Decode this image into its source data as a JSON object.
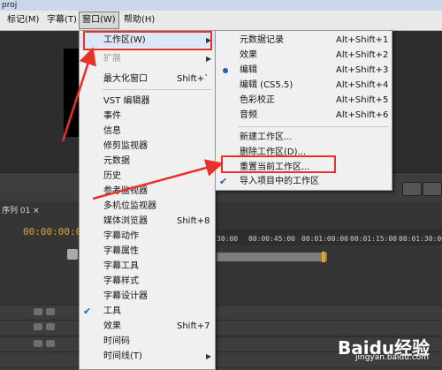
{
  "window": {
    "title": "proj"
  },
  "menubar": {
    "items": [
      {
        "label": "标记(M)",
        "id": "marker"
      },
      {
        "label": "字幕(T)",
        "id": "title"
      },
      {
        "label": "窗口(W)",
        "id": "window",
        "active": true
      },
      {
        "label": "帮助(H)",
        "id": "help"
      }
    ]
  },
  "window_menu": {
    "items": [
      {
        "label": "工作区(W)",
        "submenu": true,
        "highlighted": true
      },
      {
        "label": "扩展",
        "submenu": true,
        "disabled": true
      },
      {
        "label": "最大化窗口",
        "shortcut": "Shift+`"
      },
      {
        "label": "VST 编辑器"
      },
      {
        "label": "事件"
      },
      {
        "label": "信息"
      },
      {
        "label": "修剪监视器"
      },
      {
        "label": "元数据"
      },
      {
        "label": "历史"
      },
      {
        "label": "参考监视器"
      },
      {
        "label": "多机位监视器"
      },
      {
        "label": "媒体浏览器",
        "shortcut": "Shift+8"
      },
      {
        "label": "字幕动作"
      },
      {
        "label": "字幕属性"
      },
      {
        "label": "字幕工具"
      },
      {
        "label": "字幕样式"
      },
      {
        "label": "字幕设计器"
      },
      {
        "label": "工具",
        "checked": true
      },
      {
        "label": "效果",
        "shortcut": "Shift+7"
      },
      {
        "label": "时间码"
      },
      {
        "label": "时间线(T)",
        "submenu": true
      }
    ]
  },
  "workspace_submenu": {
    "items": [
      {
        "label": "元数据记录",
        "shortcut": "Alt+Shift+1"
      },
      {
        "label": "效果",
        "shortcut": "Alt+Shift+2"
      },
      {
        "label": "编辑",
        "shortcut": "Alt+Shift+3",
        "selected": true
      },
      {
        "label": "编辑 (CS5.5)",
        "shortcut": "Alt+Shift+4"
      },
      {
        "label": "色彩校正",
        "shortcut": "Alt+Shift+5"
      },
      {
        "label": "音频",
        "shortcut": "Alt+Shift+6"
      },
      {
        "label": "新建工作区..."
      },
      {
        "label": "删除工作区(D)..."
      },
      {
        "label": "重置当前工作区...",
        "highlighted": true
      },
      {
        "label": "导入项目中的工作区",
        "checked": true
      }
    ]
  },
  "sequence": {
    "tab_label": "序列 01 ×",
    "timecode": "00:00:00:00",
    "ruler": [
      "30:00",
      "00:00:45:00",
      "00:01:00:00",
      "00:01:15:00",
      "00:01:30:00"
    ]
  },
  "watermark": {
    "brand": "Baidu经验",
    "url": "jingyan.baidu.com"
  },
  "colors": {
    "highlight": "#e8312a",
    "timecode": "#e8a317",
    "check": "#1f5fbf"
  }
}
